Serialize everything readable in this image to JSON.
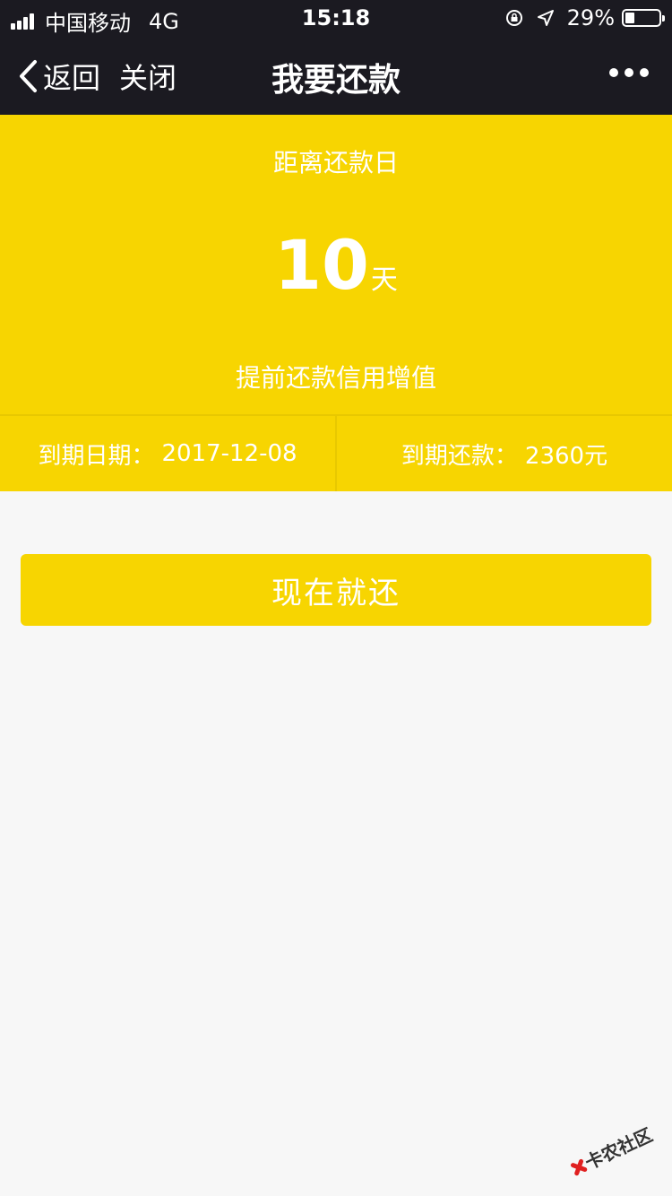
{
  "status_bar": {
    "carrier": "中国移动",
    "network": "4G",
    "time": "15:18",
    "battery": "29%",
    "battery_level": 0.29
  },
  "nav": {
    "back_label": "返回",
    "close_label": "关闭",
    "title": "我要还款"
  },
  "hero": {
    "top_label": "距离还款日",
    "days_value": "10",
    "days_unit": "天",
    "subtitle": "提前还款信用增值",
    "due_date_label": "到期日期：",
    "due_date_value": "2017-12-08",
    "due_amount_label": "到期还款：",
    "due_amount_value": "2360元"
  },
  "actions": {
    "pay_now_label": "现在就还"
  },
  "watermark": {
    "text": "卡农社区"
  },
  "colors": {
    "accent_yellow": "#f7d501",
    "nav_dark": "#1b1a21",
    "background": "#f7f7f7"
  }
}
